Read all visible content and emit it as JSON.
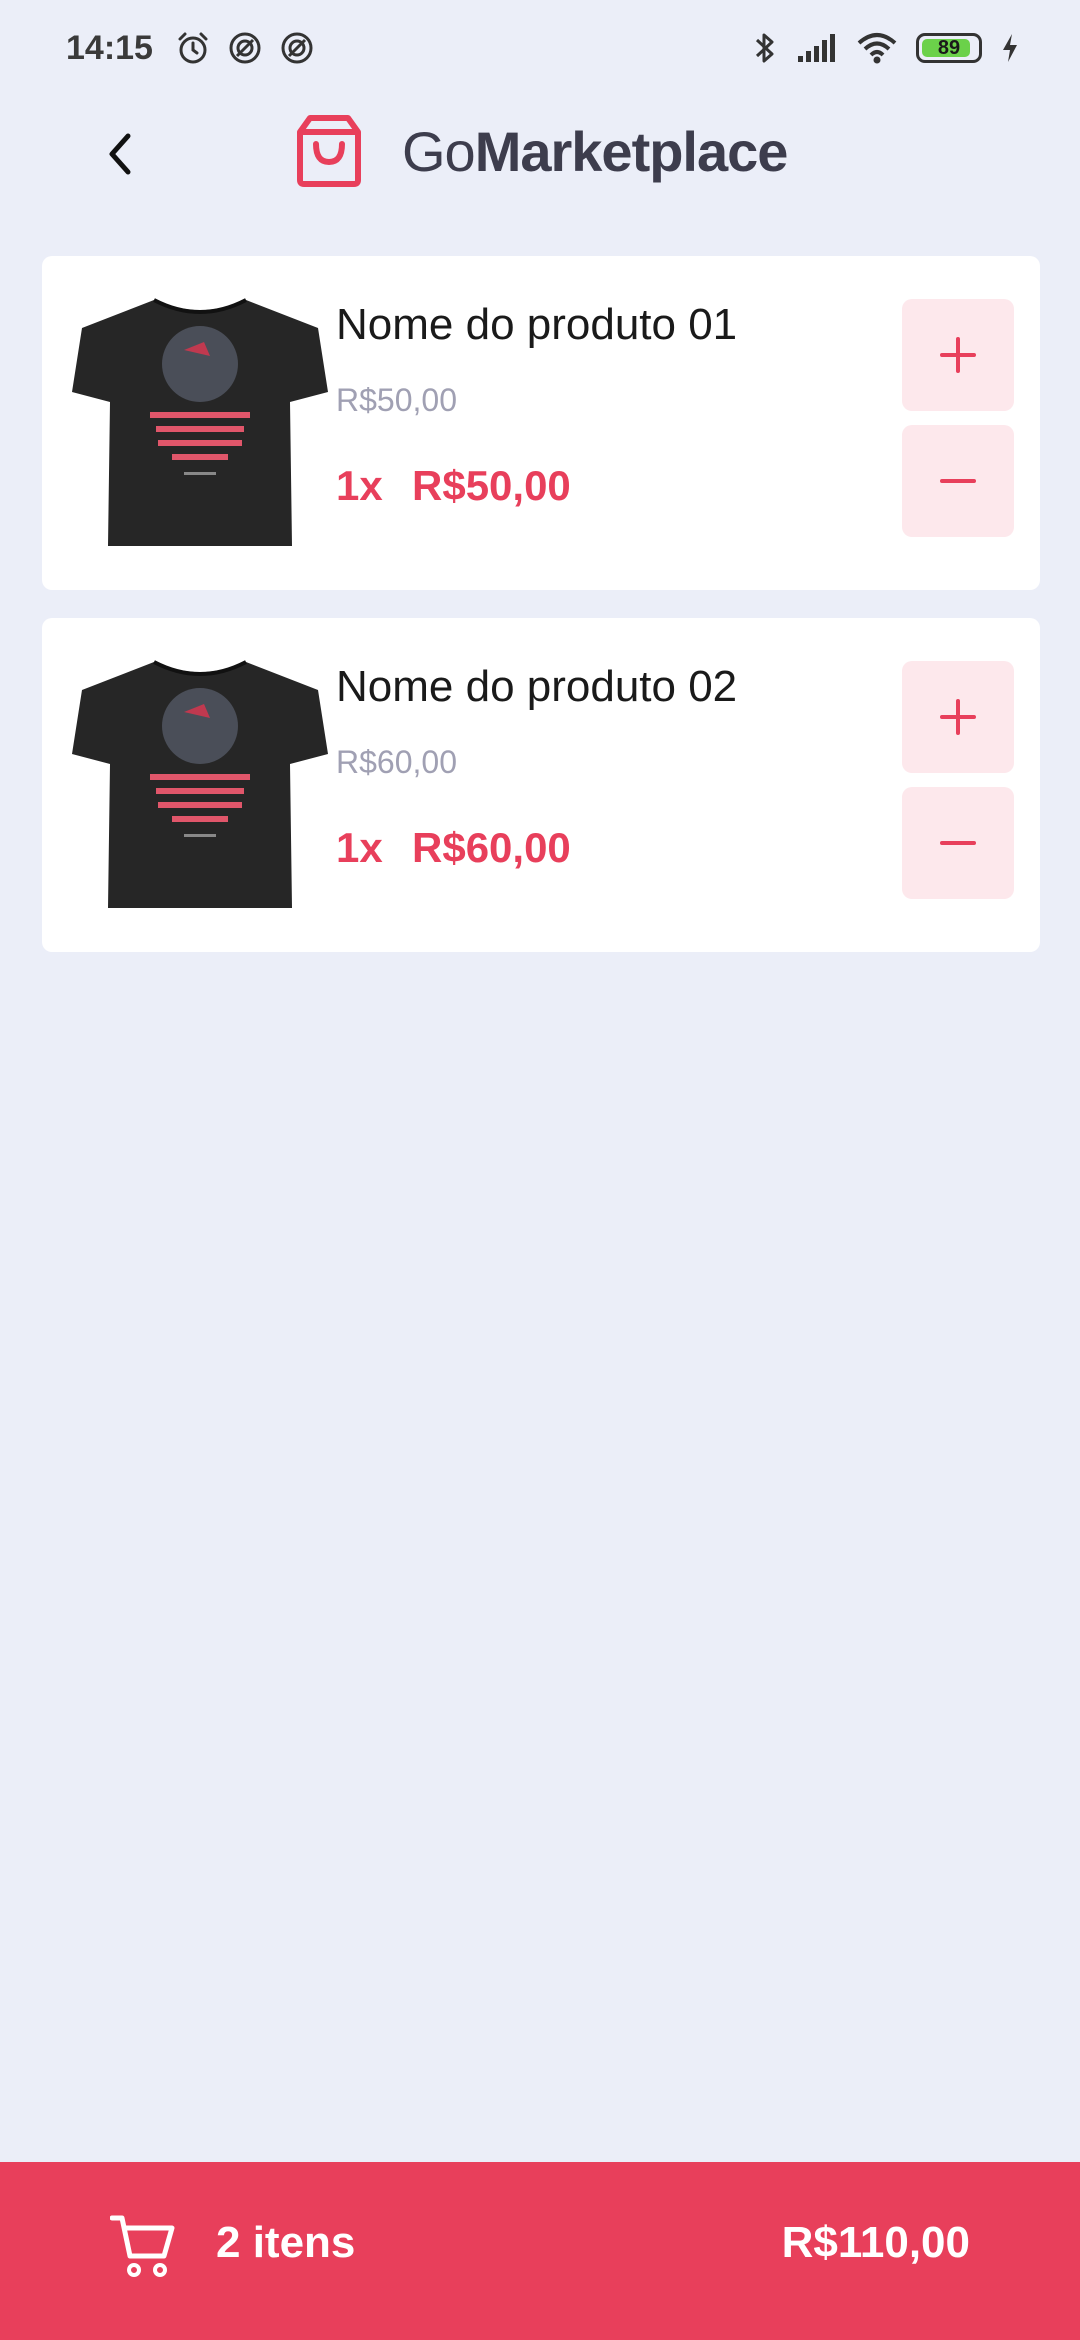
{
  "status_bar": {
    "time": "14:15",
    "battery_level": "89",
    "left_icons": [
      "alarm-icon",
      "sync-icon",
      "sync-icon"
    ],
    "right_icons": [
      "bluetooth-icon",
      "signal-icon",
      "wifi-icon",
      "battery-icon",
      "charging-icon"
    ]
  },
  "header": {
    "back_icon": "chevron-left-icon",
    "logo_icon": "shopping-bag-icon",
    "brand_prefix": "Go",
    "brand_suffix": "Marketplace"
  },
  "products": [
    {
      "title": "Nome do produto 01",
      "unit_price": "R$50,00",
      "quantity": "1x",
      "subtotal": "R$50,00",
      "image": "black-tshirt-image"
    },
    {
      "title": "Nome do produto 02",
      "unit_price": "R$60,00",
      "quantity": "1x",
      "subtotal": "R$60,00",
      "image": "black-tshirt-image"
    }
  ],
  "footer": {
    "cart_icon": "cart-icon",
    "items_label": "2 itens",
    "total": "R$110,00"
  },
  "colors": {
    "background": "#EBEEF8",
    "accent": "#E83F5B",
    "button_bg": "#FDE8EC",
    "muted_text": "#A0A0B3",
    "brand_text": "#3D3D4D"
  }
}
